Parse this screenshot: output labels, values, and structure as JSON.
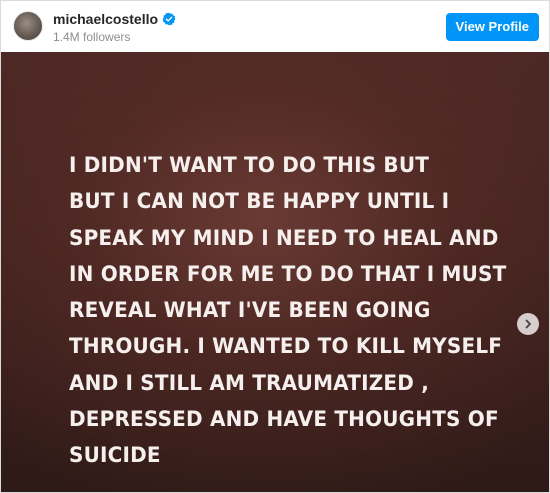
{
  "header": {
    "username": "michaelcostello",
    "followers": "1.4M followers",
    "view_profile_label": "View Profile"
  },
  "post": {
    "text": "I DIDN'T WANT TO DO THIS BUT\nBUT I CAN NOT BE HAPPY UNTIL I\nSPEAK MY MIND I NEED TO HEAL AND\nIN ORDER FOR ME TO DO THAT I MUST\nREVEAL WHAT I'VE BEEN GOING\nTHROUGH. I WANTED TO KILL MYSELF\nAND I STILL AM TRAUMATIZED ,\nDEPRESSED AND HAVE THOUGHTS OF\nSUICIDE"
  },
  "icons": {
    "verified": "verified-badge-icon",
    "next": "chevron-right-icon"
  },
  "colors": {
    "accent": "#0095f6",
    "background_dark": "#3a1f1b",
    "text_light": "#f5f0ee"
  }
}
